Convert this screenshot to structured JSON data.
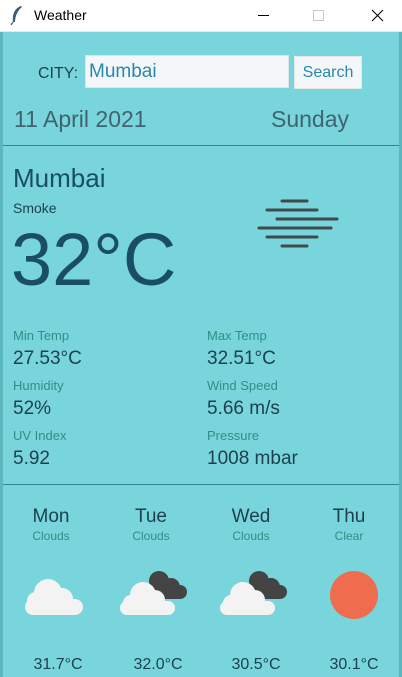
{
  "window": {
    "title": "Weather",
    "icon": "feather-icon"
  },
  "search": {
    "label": "CITY:",
    "value": "Mumbai",
    "button_label": "Search"
  },
  "date": "11 April 2021",
  "day": "Sunday",
  "current": {
    "city": "Mumbai",
    "condition": "Smoke",
    "temperature": "32°C",
    "icon": "smoke-icon"
  },
  "stats": {
    "min_temp": {
      "label": "Min Temp",
      "value": "27.53°C"
    },
    "max_temp": {
      "label": "Max Temp",
      "value": "32.51°C"
    },
    "humidity": {
      "label": "Humidity",
      "value": "52%"
    },
    "wind_speed": {
      "label": "Wind Speed",
      "value": "5.66 m/s"
    },
    "uv_index": {
      "label": "UV Index",
      "value": "5.92"
    },
    "pressure": {
      "label": "Pressure",
      "value": "1008 mbar"
    }
  },
  "forecast": [
    {
      "day": "Mon",
      "condition": "Clouds",
      "temp": "31.7°C",
      "icon": "cloud-icon"
    },
    {
      "day": "Tue",
      "condition": "Clouds",
      "temp": "32.0°C",
      "icon": "dark-clouds-icon"
    },
    {
      "day": "Wed",
      "condition": "Clouds",
      "temp": "30.5°C",
      "icon": "dark-clouds-icon"
    },
    {
      "day": "Thu",
      "condition": "Clear",
      "temp": "30.1°C",
      "icon": "sun-icon"
    }
  ],
  "colors": {
    "background": "#77d5db",
    "accent_text": "#2a86b1",
    "sun": "#ef6c4e"
  }
}
